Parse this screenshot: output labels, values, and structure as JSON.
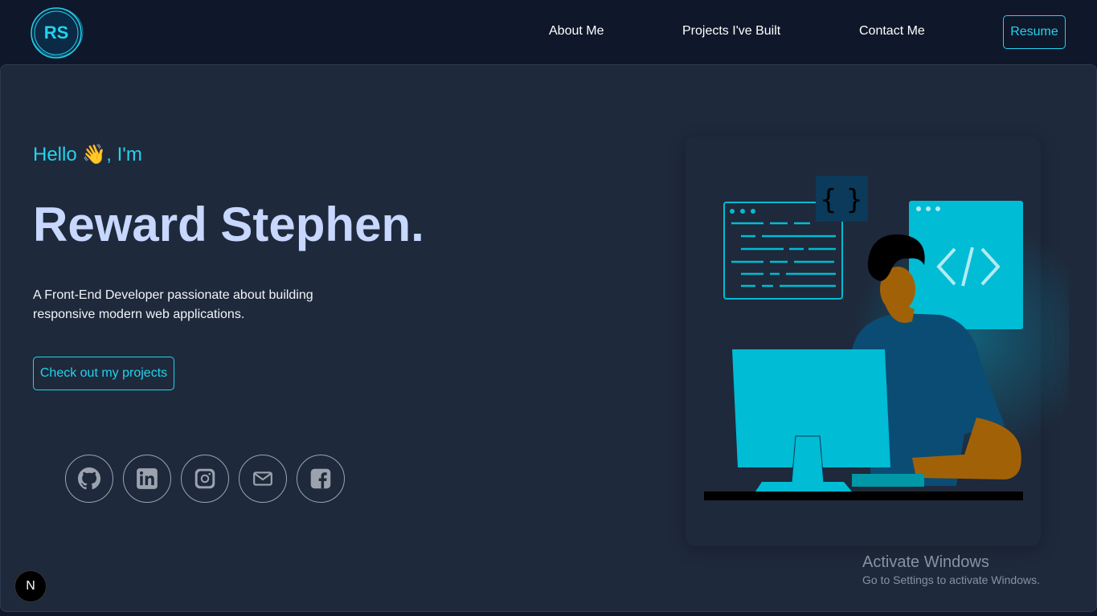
{
  "header": {
    "logo_text": "RS",
    "nav": [
      "About Me",
      "Projects I've Built",
      "Contact Me"
    ],
    "resume_label": "Resume"
  },
  "hero": {
    "greeting": "Hello 👋, I'm",
    "name": "Reward Stephen.",
    "description": "A Front-End Developer passionate about building responsive modern web applications.",
    "cta_label": "Check out my projects"
  },
  "social_icons": [
    "github-icon",
    "linkedin-icon",
    "instagram-icon",
    "mail-icon",
    "facebook-icon"
  ],
  "windows_watermark": {
    "title": "Activate Windows",
    "subtitle": "Go to Settings to activate Windows."
  },
  "next_badge": "N",
  "colors": {
    "background": "#0f172a",
    "panel": "#1e293b",
    "accent": "#22d3ee",
    "name": "#c7d7fe",
    "illustration_cyan": "#00bcd4"
  }
}
